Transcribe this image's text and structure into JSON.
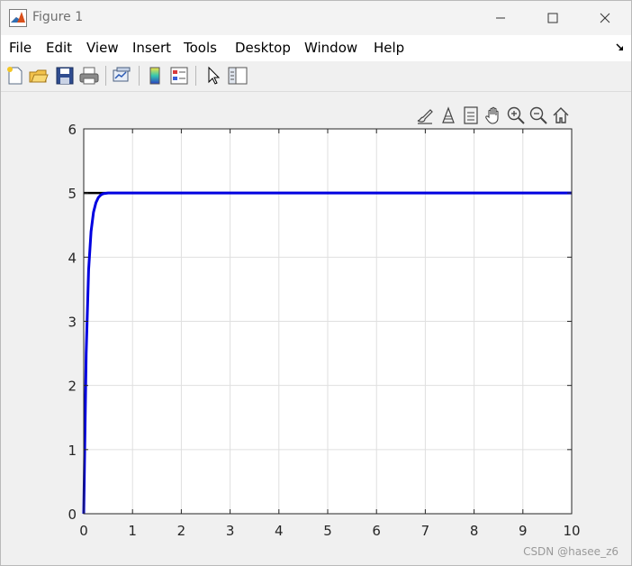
{
  "window": {
    "title": "Figure 1"
  },
  "menu": {
    "items": [
      "File",
      "Edit",
      "View",
      "Insert",
      "Tools",
      "Desktop",
      "Window",
      "Help"
    ]
  },
  "toolbar": {
    "buttons": [
      "new-figure-icon",
      "open-file-icon",
      "save-icon",
      "print-icon",
      "link-plot-icon",
      "insert-colorbar-icon",
      "insert-legend-icon",
      "edit-plot-arrow-icon",
      "property-inspector-icon"
    ]
  },
  "axes_toolbar": {
    "buttons": [
      "brush-icon",
      "data-tips-icon",
      "restore-view-icon",
      "pan-icon",
      "zoom-in-icon",
      "zoom-out-icon",
      "home-icon"
    ]
  },
  "watermark": "CSDN @hasee_z6",
  "chart_data": {
    "type": "line",
    "title": "",
    "xlabel": "",
    "ylabel": "",
    "xlim": [
      0,
      10
    ],
    "ylim": [
      0,
      6
    ],
    "x_ticks": [
      "0",
      "1",
      "2",
      "3",
      "4",
      "5",
      "6",
      "7",
      "8",
      "9",
      "10"
    ],
    "y_ticks": [
      "0",
      "1",
      "2",
      "3",
      "4",
      "5",
      "6"
    ],
    "grid": true,
    "series": [
      {
        "color": "#000000",
        "x": [
          0,
          10
        ],
        "y": [
          5,
          5
        ]
      },
      {
        "color": "#0000e0",
        "x": [
          0,
          0.05,
          0.1,
          0.15,
          0.2,
          0.25,
          0.3,
          0.35,
          0.4,
          0.5,
          0.6,
          0.8,
          1,
          2,
          4,
          6,
          8,
          10
        ],
        "y": [
          0,
          2.5,
          3.8,
          4.4,
          4.7,
          4.85,
          4.93,
          4.97,
          4.99,
          5,
          5,
          5,
          5,
          5,
          5,
          5,
          5,
          5
        ]
      }
    ]
  }
}
